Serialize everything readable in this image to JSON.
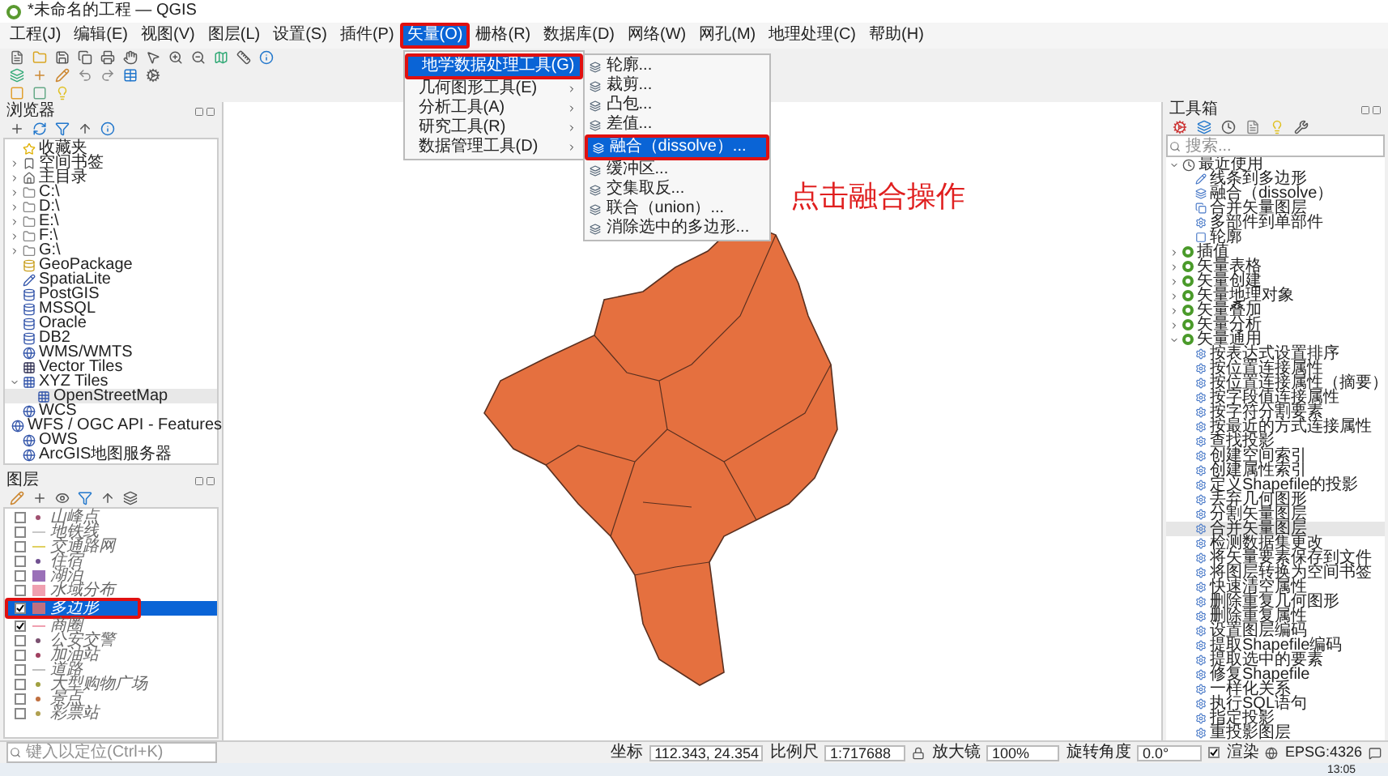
{
  "window": {
    "title": "*未命名的工程 — QGIS"
  },
  "menubar": [
    {
      "label": "工程(J)",
      "selected": false
    },
    {
      "label": "编辑(E)",
      "selected": false
    },
    {
      "label": "视图(V)",
      "selected": false
    },
    {
      "label": "图层(L)",
      "selected": false
    },
    {
      "label": "设置(S)",
      "selected": false
    },
    {
      "label": "插件(P)",
      "selected": false
    },
    {
      "label": "矢量(O)",
      "selected": true
    },
    {
      "label": "栅格(R)",
      "selected": false
    },
    {
      "label": "数据库(D)",
      "selected": false
    },
    {
      "label": "网络(W)",
      "selected": false
    },
    {
      "label": "网孔(M)",
      "selected": false
    },
    {
      "label": "地理处理(C)",
      "selected": false
    },
    {
      "label": "帮助(H)",
      "selected": false
    }
  ],
  "vector_menu": [
    {
      "label": "地学数据处理工具(G)",
      "selected": true
    },
    {
      "label": "几何图形工具(E)",
      "selected": false
    },
    {
      "label": "分析工具(A)",
      "selected": false
    },
    {
      "label": "研究工具(R)",
      "selected": false
    },
    {
      "label": "数据管理工具(D)",
      "selected": false
    }
  ],
  "submenu": [
    {
      "label": "轮廓...",
      "selected": false
    },
    {
      "label": "裁剪...",
      "selected": false
    },
    {
      "label": "凸包...",
      "selected": false
    },
    {
      "label": "差值...",
      "selected": false
    },
    {
      "label": "融合（dissolve）...",
      "selected": true
    },
    {
      "label": "缓冲区...",
      "selected": false
    },
    {
      "label": "交集取反...",
      "selected": false
    },
    {
      "label": "联合（union）...",
      "selected": false
    },
    {
      "label": "消除选中的多边形...",
      "selected": false
    }
  ],
  "browser": {
    "title": "浏览器",
    "items": [
      {
        "label": "收藏夹"
      },
      {
        "label": "空间书签",
        "expanded": false
      },
      {
        "label": "主目录",
        "expanded": false
      },
      {
        "label": "C:\\",
        "expanded": false
      },
      {
        "label": "D:\\",
        "expanded": false
      },
      {
        "label": "E:\\",
        "expanded": false
      },
      {
        "label": "F:\\",
        "expanded": false
      },
      {
        "label": "G:\\",
        "expanded": false
      },
      {
        "label": "GeoPackage"
      },
      {
        "label": "SpatiaLite"
      },
      {
        "label": "PostGIS"
      },
      {
        "label": "MSSQL"
      },
      {
        "label": "Oracle"
      },
      {
        "label": "DB2"
      },
      {
        "label": "WMS/WMTS"
      },
      {
        "label": "Vector Tiles"
      },
      {
        "label": "XYZ Tiles",
        "expanded": true,
        "children": [
          {
            "label": "OpenStreetMap",
            "selected": true
          }
        ]
      },
      {
        "label": "WCS"
      },
      {
        "label": "WFS / OGC API - Features"
      },
      {
        "label": "OWS"
      },
      {
        "label": "ArcGIS地图服务器"
      }
    ]
  },
  "layers": {
    "title": "图层",
    "items": [
      {
        "label": "山峰点",
        "kind": "point",
        "color": "#a05070",
        "checked": false,
        "selected": false
      },
      {
        "label": "地铁线",
        "kind": "line",
        "color": "#c8c8c8",
        "checked": false,
        "selected": false
      },
      {
        "label": "交通路网",
        "kind": "line",
        "color": "#e0d060",
        "checked": false,
        "selected": false
      },
      {
        "label": "住宿",
        "kind": "point",
        "color": "#705090",
        "checked": false,
        "selected": false
      },
      {
        "label": "湖泊",
        "kind": "polygon",
        "color": "#9a70b8",
        "checked": false,
        "selected": false
      },
      {
        "label": "水域分布",
        "kind": "polygon",
        "color": "#f0a0b0",
        "checked": false,
        "selected": false
      },
      {
        "label": "多边形",
        "kind": "polygon",
        "color": "#c07080",
        "checked": true,
        "selected": true
      },
      {
        "label": "商圈",
        "kind": "line",
        "color": "#f0a0b0",
        "checked": true,
        "selected": false
      },
      {
        "label": "公安交警",
        "kind": "point",
        "color": "#7a5070",
        "checked": false,
        "selected": false
      },
      {
        "label": "加油站",
        "kind": "point",
        "color": "#a04060",
        "checked": false,
        "selected": false
      },
      {
        "label": "道路",
        "kind": "line",
        "color": "#c0c0c0",
        "checked": false,
        "selected": false
      },
      {
        "label": "大型购物广场",
        "kind": "point",
        "color": "#a0a040",
        "checked": false,
        "selected": false
      },
      {
        "label": "景点",
        "kind": "point",
        "color": "#c07040",
        "checked": false,
        "selected": false
      },
      {
        "label": "彩票站",
        "kind": "point",
        "color": "#b0a050",
        "checked": false,
        "selected": false
      }
    ]
  },
  "annotation": "点击融合操作",
  "toolbox": {
    "title": "工具箱",
    "search": {
      "placeholder": "搜索..."
    },
    "groups": [
      {
        "label": "最近使用",
        "kind": "recent",
        "expanded": true,
        "children": [
          {
            "label": "线条到多边形",
            "selected": false
          },
          {
            "label": "融合（dissolve）",
            "selected": false
          },
          {
            "label": "合并矢量图层",
            "selected": false
          },
          {
            "label": "多部件到单部件",
            "selected": false
          },
          {
            "label": "轮廓",
            "selected": false
          }
        ]
      },
      {
        "label": "插值",
        "kind": "group",
        "expanded": false
      },
      {
        "label": "矢量表格",
        "kind": "group",
        "expanded": false
      },
      {
        "label": "矢量创建",
        "kind": "group",
        "expanded": false
      },
      {
        "label": "矢量地理对象",
        "kind": "group",
        "expanded": false
      },
      {
        "label": "矢量叠加",
        "kind": "group",
        "expanded": false
      },
      {
        "label": "矢量分析",
        "kind": "group",
        "expanded": false
      },
      {
        "label": "矢量通用",
        "kind": "group",
        "expanded": true,
        "children": [
          {
            "label": "按表达式设置排序",
            "selected": false
          },
          {
            "label": "按位置连接属性",
            "selected": false
          },
          {
            "label": "按位置连接属性（摘要）",
            "selected": false
          },
          {
            "label": "按字段值连接属性",
            "selected": false
          },
          {
            "label": "按字符分割要素",
            "selected": false
          },
          {
            "label": "按最近的方式连接属性",
            "selected": false
          },
          {
            "label": "查找投影",
            "selected": false
          },
          {
            "label": "创建空间索引",
            "selected": false
          },
          {
            "label": "创建属性索引",
            "selected": false
          },
          {
            "label": "定义Shapefile的投影",
            "selected": false
          },
          {
            "label": "丢弃几何图形",
            "selected": false
          },
          {
            "label": "分割矢量图层",
            "selected": false
          },
          {
            "label": "合并矢量图层",
            "selected": true
          },
          {
            "label": "检测数据集更改",
            "selected": false
          },
          {
            "label": "将矢量要素保存到文件",
            "selected": false
          },
          {
            "label": "将图层转换为空间书签",
            "selected": false
          },
          {
            "label": "快速清空属性",
            "selected": false
          },
          {
            "label": "删除重复几何图形",
            "selected": false
          },
          {
            "label": "删除重复属性",
            "selected": false
          },
          {
            "label": "设置图层编码",
            "selected": false
          },
          {
            "label": "提取Shapefile编码",
            "selected": false
          },
          {
            "label": "提取选中的要素",
            "selected": false
          },
          {
            "label": "修复Shapefile",
            "selected": false
          },
          {
            "label": "一样化关系",
            "selected": false
          },
          {
            "label": "执行SQL语句",
            "selected": false
          },
          {
            "label": "指定投影",
            "selected": false
          },
          {
            "label": "重投影图层",
            "selected": false
          }
        ]
      }
    ]
  },
  "status_bar": {
    "search": {
      "placeholder": "键入以定位(Ctrl+K)"
    },
    "coordinate_label": "坐标",
    "coordinate": "112.343, 24.354",
    "scale_label": "比例尺",
    "scale": "1:717688",
    "magnifier_label": "放大镜",
    "magnifier": "100%",
    "rotation_label": "旋转角度",
    "rotation": "0.0°",
    "render_label": "渲染",
    "render_checked": true,
    "crs": "EPSG:4326"
  },
  "clock": "13:05"
}
